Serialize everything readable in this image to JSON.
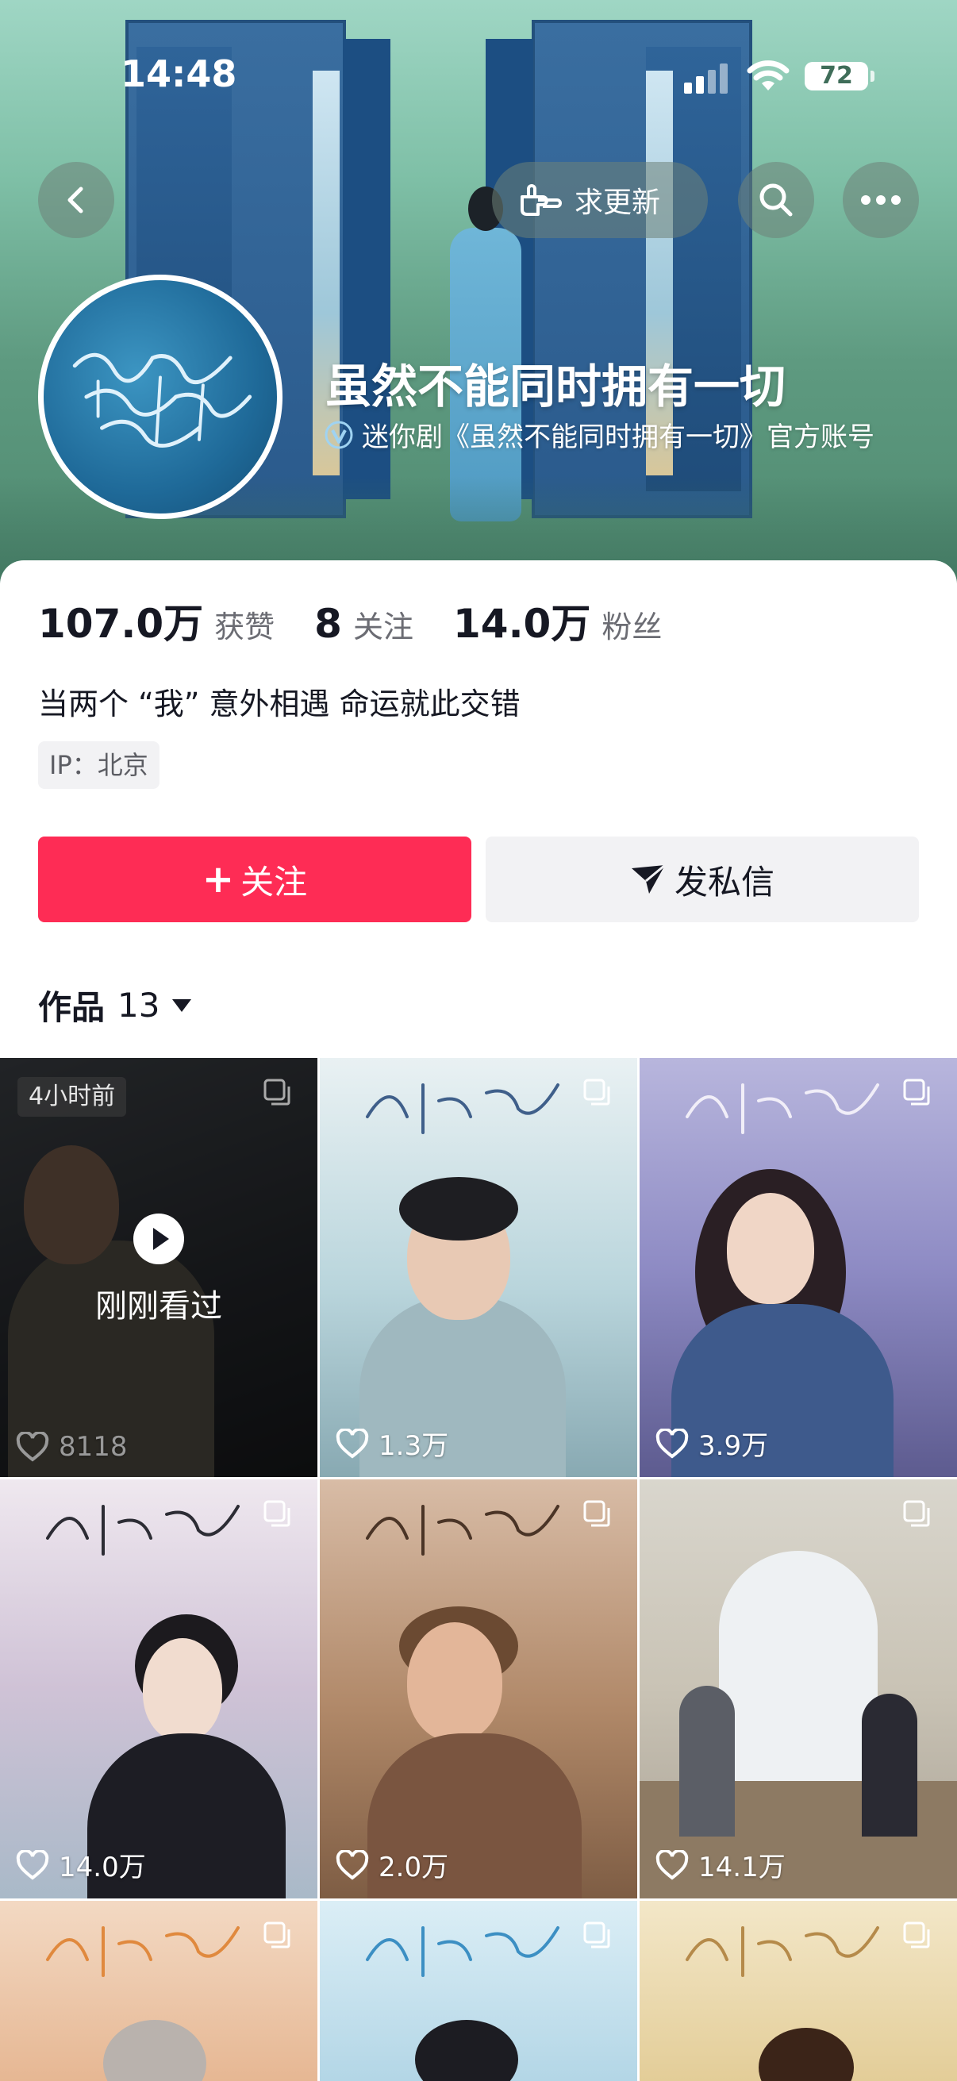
{
  "status_bar": {
    "time": "14:48",
    "battery": "72"
  },
  "header": {
    "update_label": "求更新",
    "profile_name": "虽然不能同时拥有一切",
    "verify_text": "迷你剧《虽然不能同时拥有一切》官方账号"
  },
  "stats": {
    "likes_value": "107.0万",
    "likes_label": "获赞",
    "following_value": "8",
    "following_label": "关注",
    "fans_value": "14.0万",
    "fans_label": "粉丝"
  },
  "bio": "当两个 “我” 意外相遇 命运就此交错",
  "ip": "IP：北京",
  "actions": {
    "follow_label": "关注",
    "follow_plus": "+",
    "message_label": "发私信"
  },
  "works": {
    "label": "作品",
    "count": "13"
  },
  "videos": [
    {
      "likes": "8118",
      "time_ago": "4小时前",
      "recent_label": "刚刚看过"
    },
    {
      "likes": "1.3万"
    },
    {
      "likes": "3.9万"
    },
    {
      "likes": "14.0万"
    },
    {
      "likes": "2.0万"
    },
    {
      "likes": "14.1万"
    },
    {
      "likes": ""
    },
    {
      "likes": ""
    },
    {
      "likes": ""
    }
  ],
  "colors": {
    "follow_button": "#fe2c55",
    "accent_verify": "#4aa3df"
  }
}
